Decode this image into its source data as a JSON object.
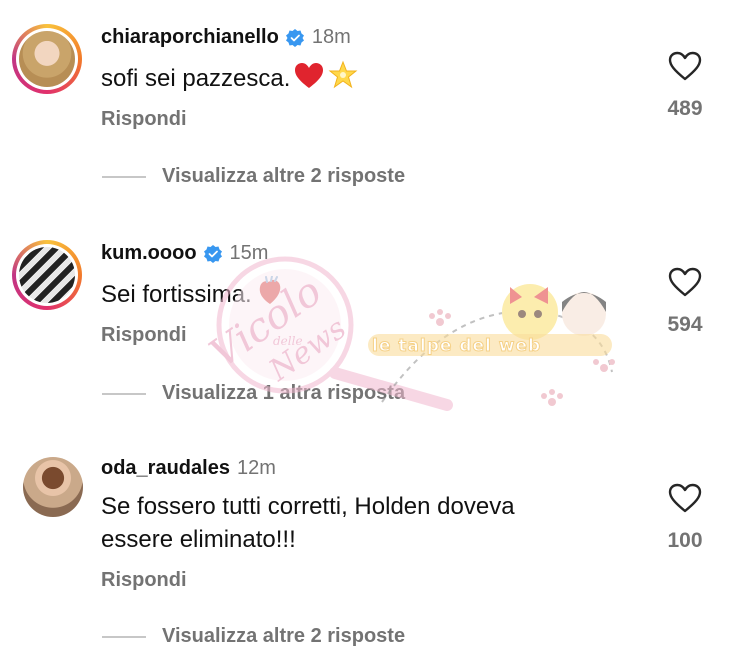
{
  "comments": [
    {
      "username": "chiaraporchianello",
      "verified": true,
      "time": "18m",
      "text": "sofi sei pazzesca.",
      "emojis": [
        "red-heart",
        "glowing-star"
      ],
      "reply_label": "Rispondi",
      "likes": "489",
      "more_replies": "Visualizza altre 2 risposte",
      "avatar_story_ring": true
    },
    {
      "username": "kum.oooo",
      "verified": true,
      "time": "15m",
      "text": "Sei fortissima.",
      "emojis": [
        "anatomical-heart"
      ],
      "reply_label": "Rispondi",
      "likes": "594",
      "more_replies": "Visualizza 1 altra risposta",
      "avatar_story_ring": true
    },
    {
      "username": "oda_raudales",
      "verified": false,
      "time": "12m",
      "text_line1": "Se fossero tutti corretti, Holden doveva",
      "text_line2": "essere eliminato!!!",
      "reply_label": "Rispondi",
      "likes": "100",
      "more_replies": "Visualizza altre 2 risposte",
      "avatar_story_ring": false
    }
  ],
  "watermarks": {
    "left_logo": "Vicolo delle News",
    "right_logo": "le talpe del web"
  },
  "colors": {
    "text_primary": "#111111",
    "text_secondary": "#737373",
    "verified_blue": "#3897f0",
    "divider": "#c7c7c7"
  }
}
